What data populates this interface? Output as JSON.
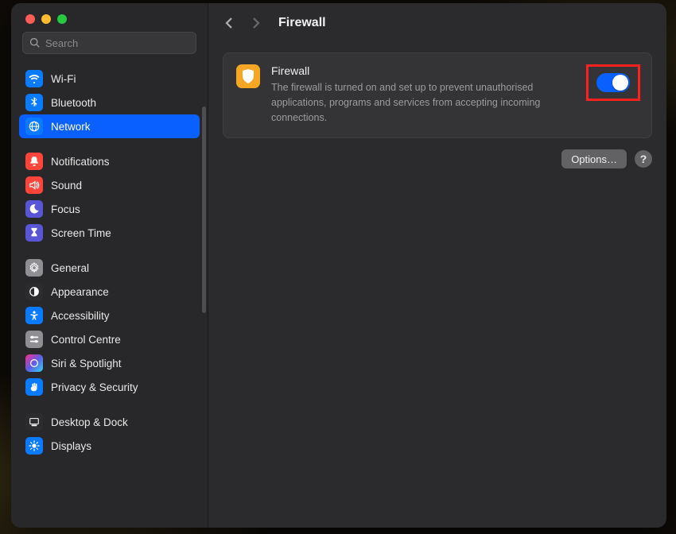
{
  "search": {
    "placeholder": "Search"
  },
  "sidebar": {
    "groups": [
      {
        "items": [
          {
            "label": "Wi-Fi",
            "icon": "wifi",
            "color": "#0a7aff"
          },
          {
            "label": "Bluetooth",
            "icon": "bluetooth",
            "color": "#0a7aff"
          },
          {
            "label": "Network",
            "icon": "globe",
            "color": "#0a7aff",
            "selected": true
          }
        ]
      },
      {
        "items": [
          {
            "label": "Notifications",
            "icon": "bell",
            "color": "#ff4539"
          },
          {
            "label": "Sound",
            "icon": "speaker",
            "color": "#ff4539"
          },
          {
            "label": "Focus",
            "icon": "moon",
            "color": "#5856d6"
          },
          {
            "label": "Screen Time",
            "icon": "hourglass",
            "color": "#5856d6"
          }
        ]
      },
      {
        "items": [
          {
            "label": "General",
            "icon": "gear",
            "color": "#8e8e93"
          },
          {
            "label": "Appearance",
            "icon": "contrast",
            "color": "#2c2c2e"
          },
          {
            "label": "Accessibility",
            "icon": "person",
            "color": "#0a7aff"
          },
          {
            "label": "Control Centre",
            "icon": "sliders",
            "color": "#8e8e93"
          },
          {
            "label": "Siri & Spotlight",
            "icon": "siri",
            "color": "#2c2c2e"
          },
          {
            "label": "Privacy & Security",
            "icon": "hand",
            "color": "#0a7aff"
          }
        ]
      },
      {
        "items": [
          {
            "label": "Desktop & Dock",
            "icon": "dock",
            "color": "#2c2c2e"
          },
          {
            "label": "Displays",
            "icon": "display",
            "color": "#0a7aff"
          }
        ]
      }
    ]
  },
  "page": {
    "title": "Firewall",
    "card": {
      "title": "Firewall",
      "description": "The firewall is turned on and set up to prevent unauthorised applications, programs and services from accepting incoming connections.",
      "toggle_on": true
    },
    "options_label": "Options…",
    "help_label": "?"
  },
  "highlight": {
    "target": "firewall-toggle",
    "color": "#ff2020"
  }
}
